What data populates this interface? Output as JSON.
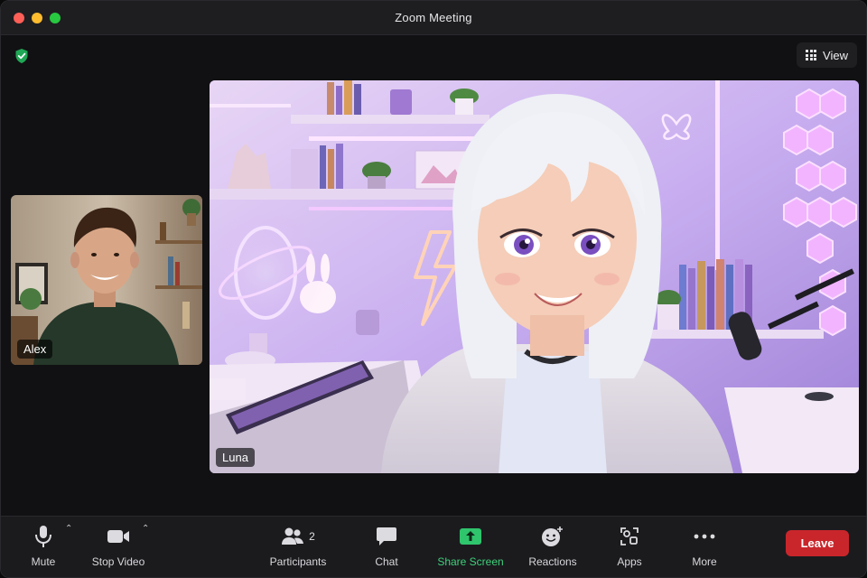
{
  "window": {
    "title": "Zoom Meeting"
  },
  "header": {
    "security_icon": "shield-check-icon",
    "view_label": "View",
    "view_icon": "grid-icon"
  },
  "participants_video": [
    {
      "name": "Alex",
      "role": "thumbnail"
    },
    {
      "name": "Luna",
      "role": "active-speaker"
    }
  ],
  "toolbar": {
    "mute_label": "Mute",
    "stop_video_label": "Stop Video",
    "participants_label": "Participants",
    "participants_count": "2",
    "chat_label": "Chat",
    "share_screen_label": "Share Screen",
    "reactions_label": "Reactions",
    "apps_label": "Apps",
    "more_label": "More",
    "leave_label": "Leave"
  },
  "colors": {
    "accent_green": "#3fd07a",
    "leave_red": "#c9262b",
    "toolbar_bg": "#1b1b1e",
    "window_bg": "#121214"
  }
}
